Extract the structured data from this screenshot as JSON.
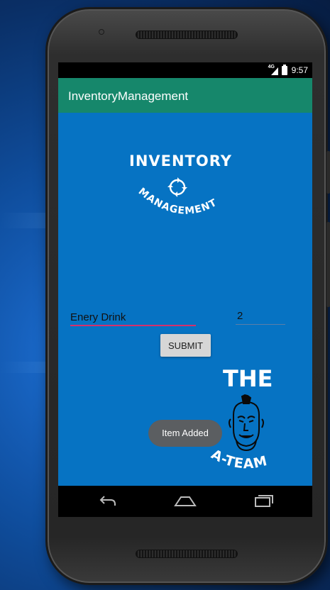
{
  "status_bar": {
    "network": "4G",
    "time": "9:57"
  },
  "app_bar": {
    "title": "InventoryManagement"
  },
  "logo": {
    "line1": "INVENTORY",
    "line2": "MANAGEMENT"
  },
  "form": {
    "item_value": "Enery Drink",
    "quantity_value": "2",
    "submit_label": "SUBMIT"
  },
  "team_logo": {
    "top": "THE",
    "bottom": "A-TEAM"
  },
  "toast": {
    "message": "Item Added"
  },
  "colors": {
    "app_bar": "#16876b",
    "content_bg": "#0673c3",
    "input_accent": "#d5306c",
    "toast_bg": "#5b5e61"
  },
  "icons": [
    "signal-icon",
    "battery-icon",
    "refresh-arrows-icon",
    "back-icon",
    "home-icon",
    "recents-icon"
  ]
}
